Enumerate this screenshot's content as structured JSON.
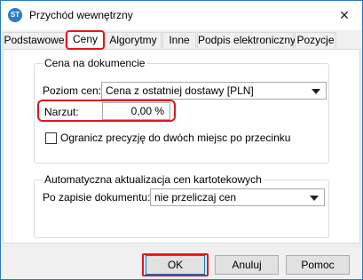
{
  "window": {
    "title": "Przychód wewnętrzny",
    "icon": "app-logo-icon",
    "close_icon": "close-icon",
    "close_glyph": "✕",
    "icon_text": "ST"
  },
  "tabs": [
    {
      "label": "Podstawowe"
    },
    {
      "label": "Ceny",
      "active": true
    },
    {
      "label": "Algorytmy"
    },
    {
      "label": "Inne"
    },
    {
      "label": "Podpis elektroniczny"
    },
    {
      "label": "Pozycje"
    }
  ],
  "price_group": {
    "legend": "Cena na dokumencie",
    "level_label": "Poziom cen:",
    "level_value": "Cena z ostatniej dostawy [PLN]",
    "markup_label": "Narzut:",
    "markup_value": "0,00 %",
    "checkbox_label": "Ogranicz precyzję do dwóch miejsc po przecinku",
    "checkbox_checked": false
  },
  "auto_group": {
    "legend": "Automatyczna aktualizacja cen kartotekowych",
    "after_save_label": "Po zapisie dokumentu:",
    "after_save_value": "nie przeliczaj cen"
  },
  "buttons": {
    "ok": "OK",
    "cancel": "Anuluj",
    "help": "Pomoc"
  },
  "colors": {
    "highlight": "#e3141f",
    "accent": "#0078d7",
    "window_border": "#2b79c2"
  }
}
